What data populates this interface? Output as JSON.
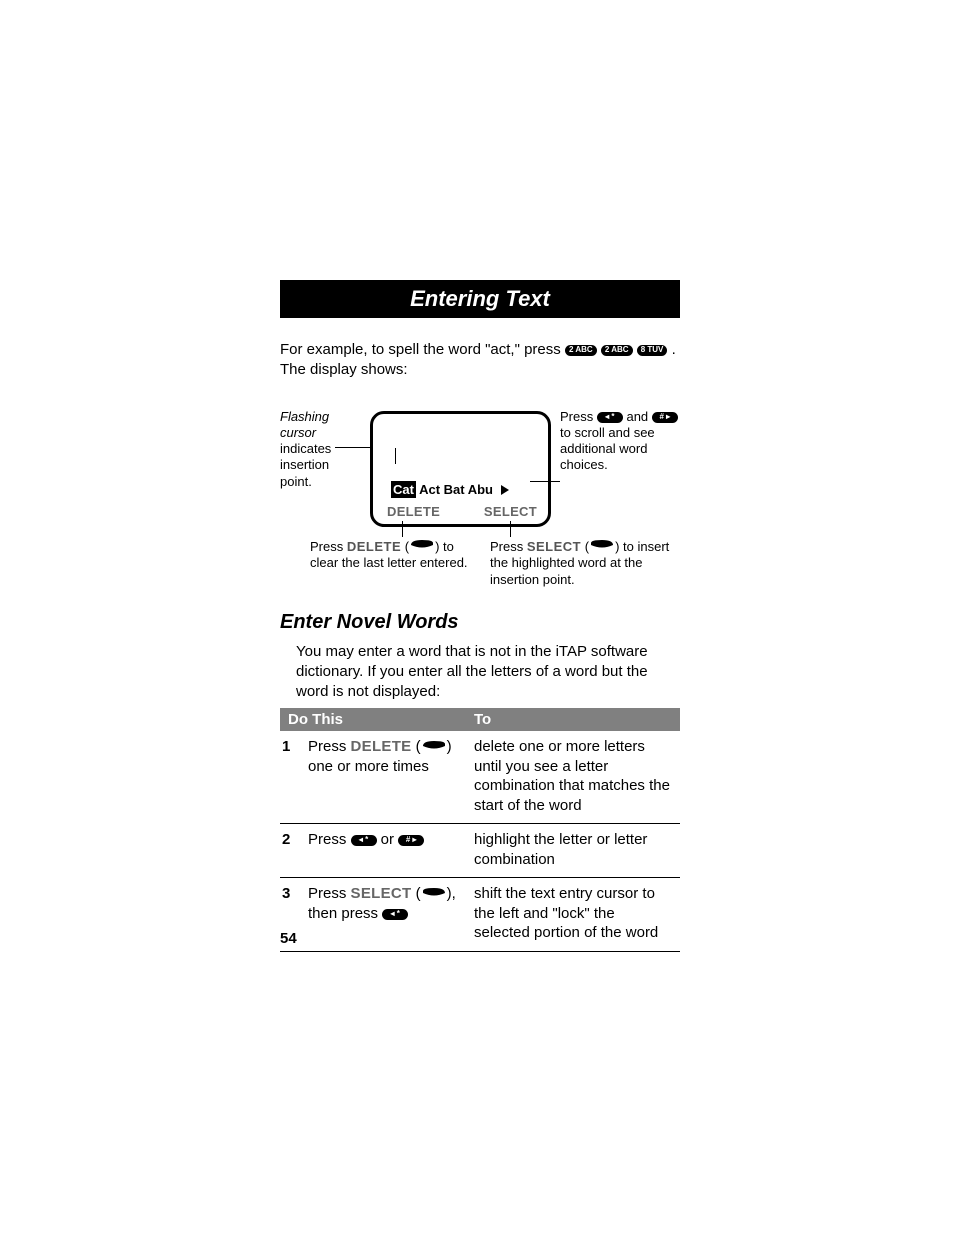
{
  "header": {
    "title": "Entering Text"
  },
  "intro": {
    "prefix": "For example, to spell the word \"act,\" press ",
    "keys": [
      "2 ABC",
      "2 ABC",
      "8 TUV"
    ],
    "suffix": ". The display shows:"
  },
  "diagram": {
    "leftCallout": {
      "lead": "Flashing cursor",
      "rest": " indicates insertion point."
    },
    "rightCallout": {
      "prefix": "Press ",
      "and": " and ",
      "rest": " to scroll and see additional word choices."
    },
    "words": {
      "highlight": "Cat",
      "others": " Act Bat Abu"
    },
    "softLeft": "DELETE",
    "softRight": "SELECT",
    "bottomLeft": {
      "prefix": "Press ",
      "label": "DELETE",
      "mid": " (",
      "close": ") to clear the last letter entered."
    },
    "bottomRight": {
      "prefix": "Press ",
      "label": "SELECT",
      "mid": " (",
      "close": ") to insert the highlighted word at the insertion point."
    }
  },
  "novel": {
    "heading": "Enter Novel Words",
    "para": "You may enter a word that is not in the iTAP software dictionary. If you enter all the letters of a word but the word is not displayed:"
  },
  "table": {
    "headDo": "Do This",
    "headTo": "To",
    "rows": [
      {
        "n": "1",
        "do_prefix": "Press ",
        "do_label": "DELETE",
        "do_mid": " (",
        "do_close": ") one or more times",
        "to": "delete one or more letters until you see a letter combination that matches the start of the word"
      },
      {
        "n": "2",
        "do_prefix": "Press ",
        "do_or": " or ",
        "to": "highlight the letter or letter combination"
      },
      {
        "n": "3",
        "do_prefix": "Press ",
        "do_label": "SELECT",
        "do_mid": " (",
        "do_close": "), then press ",
        "to": "shift the text entry cursor to the left and \"lock\" the selected portion of the word"
      }
    ]
  },
  "pageNumber": "54"
}
